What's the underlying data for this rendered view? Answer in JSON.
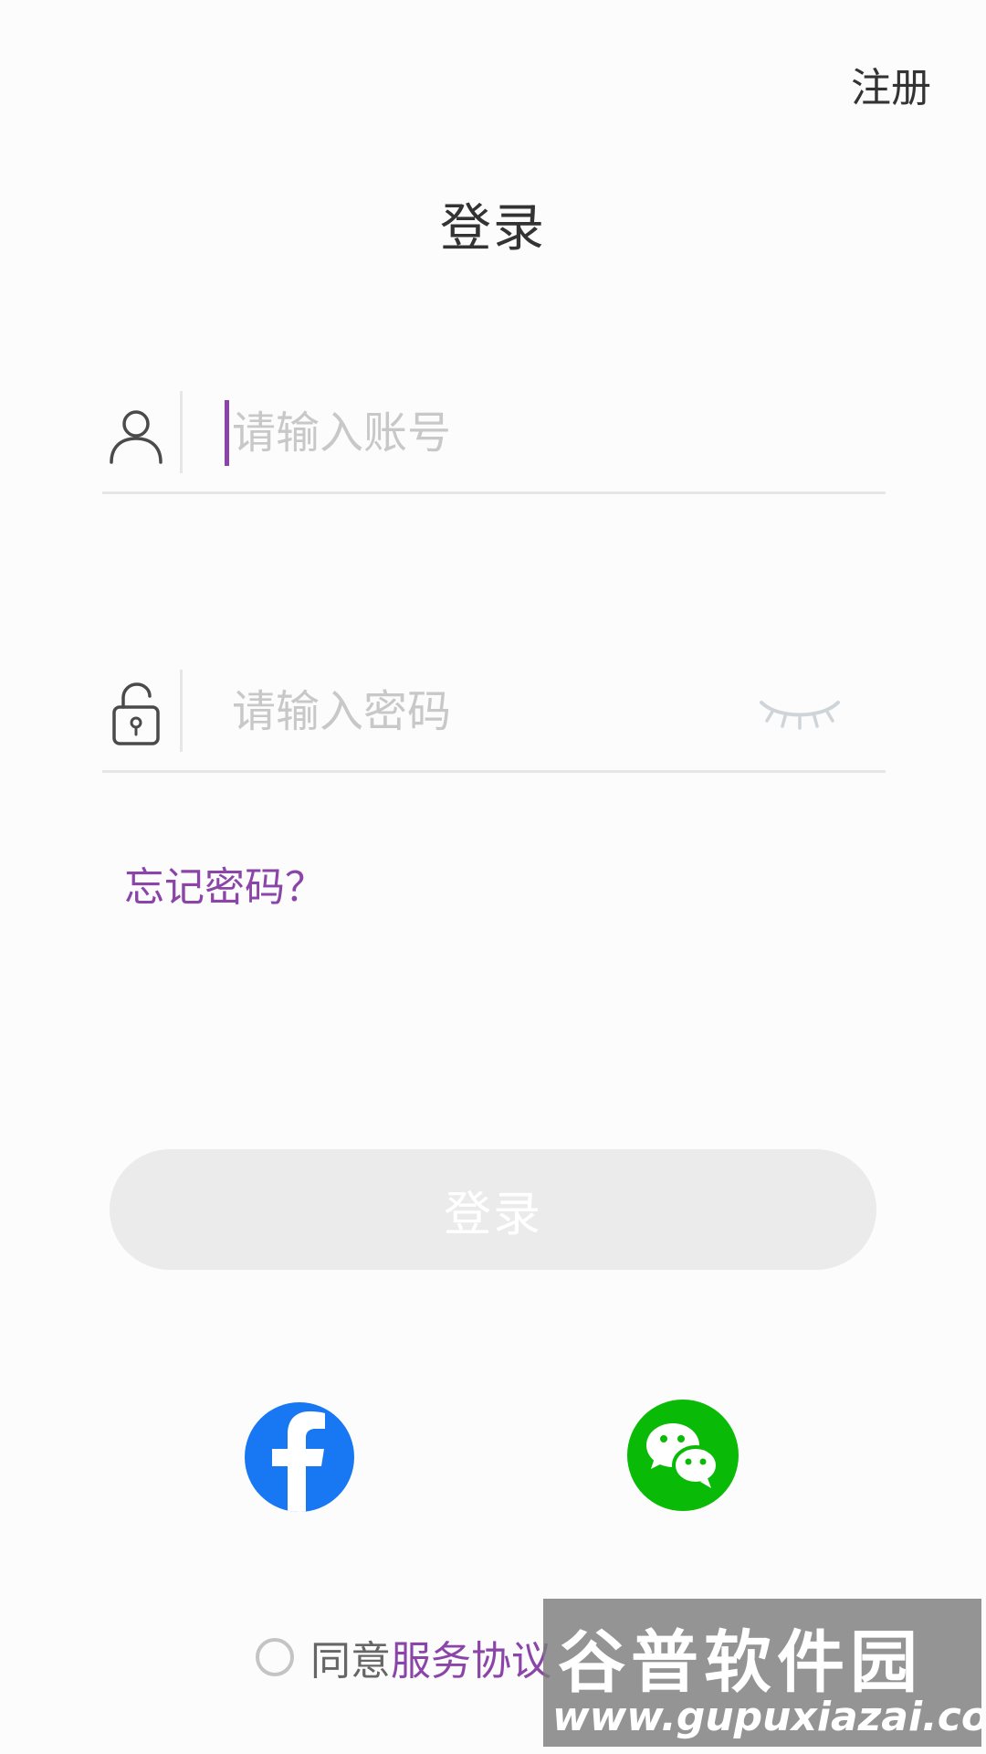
{
  "header": {
    "register_label": "注册",
    "title": "登录"
  },
  "form": {
    "account_placeholder": "请输入账号",
    "password_placeholder": "请输入密码",
    "forgot_label": "忘记密码？",
    "login_label": "登录"
  },
  "social": {
    "facebook_icon": "facebook-icon",
    "wechat_icon": "wechat-icon",
    "facebook_color": "#1877f2",
    "wechat_color": "#09bb07"
  },
  "agreement": {
    "prefix": "同意",
    "terms_link": "服务协议"
  },
  "watermark": {
    "title": "谷普软件园",
    "url": "www.gupuxiazai.com"
  },
  "colors": {
    "accent": "#8b45a8",
    "button_disabled_bg": "#ebebeb"
  }
}
